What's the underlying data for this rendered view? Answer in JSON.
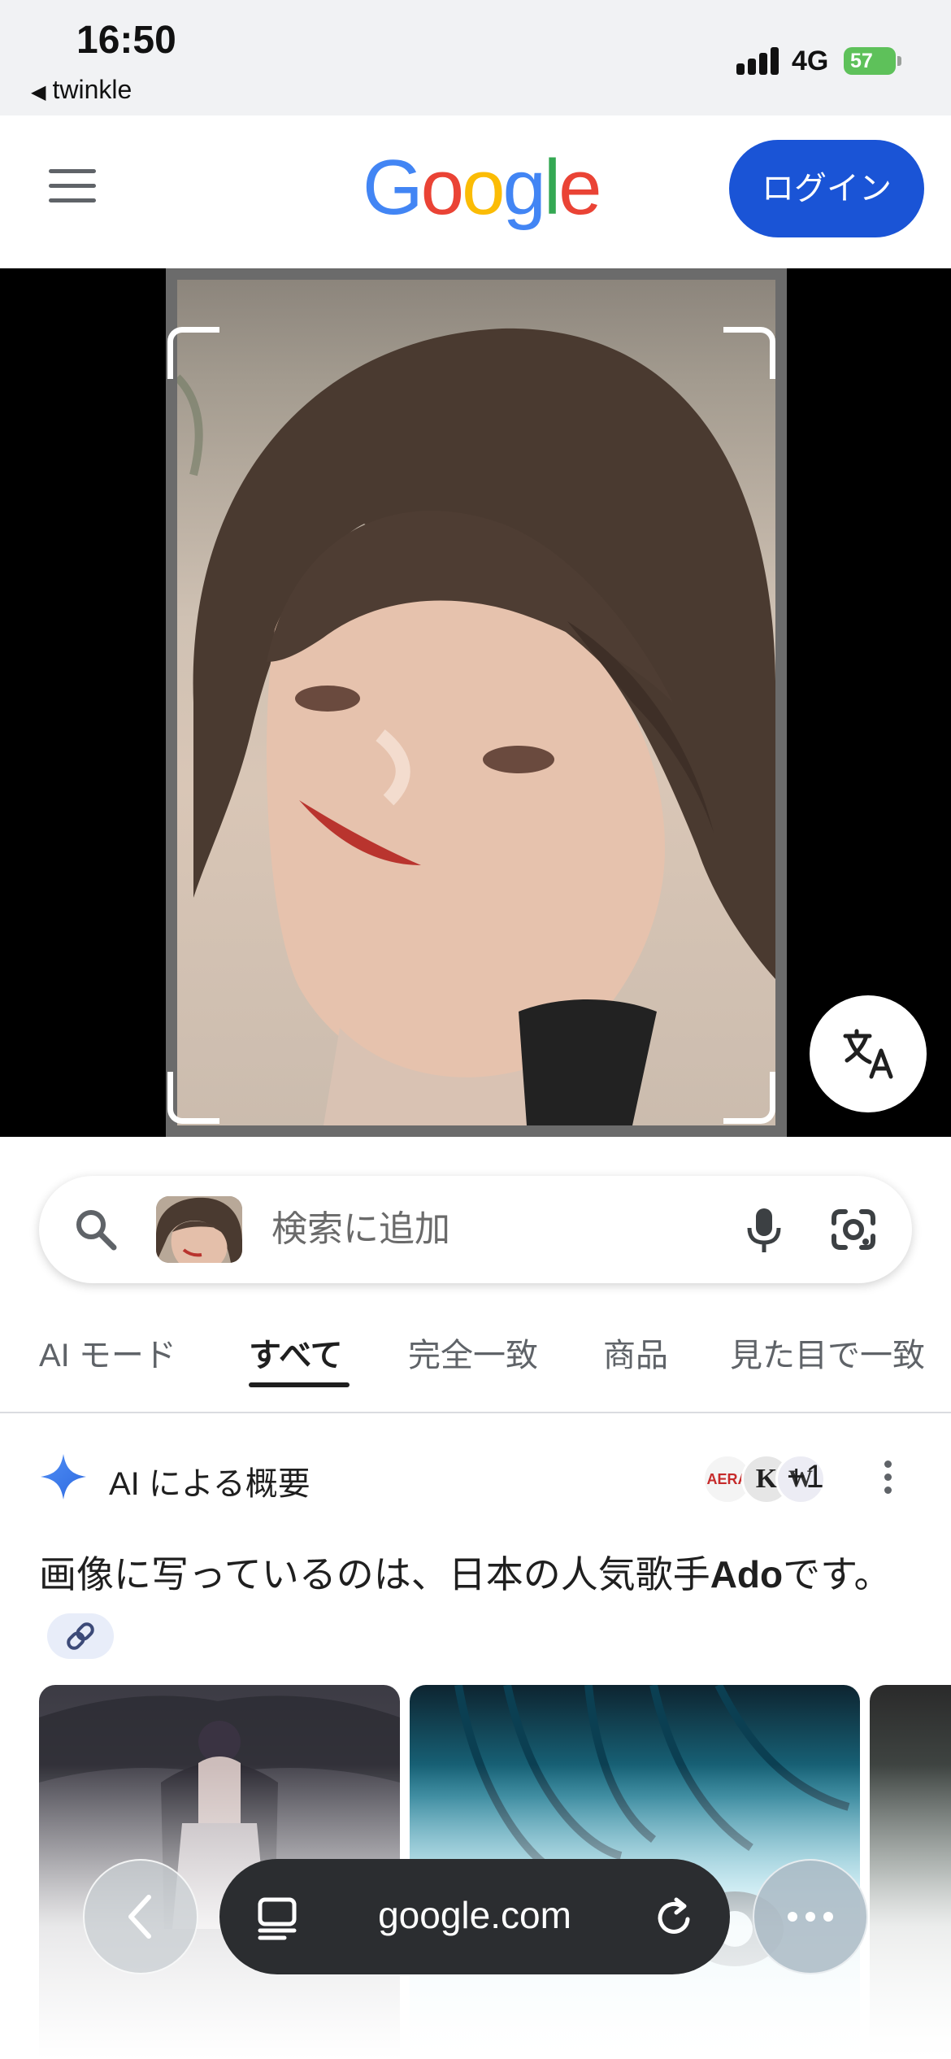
{
  "status_bar": {
    "time": "16:50",
    "back_app": "twinkle",
    "network": "4G",
    "battery": "57"
  },
  "header": {
    "logo": "Google",
    "logo_colors": [
      "#4285F4",
      "#EA4335",
      "#FBBC05",
      "#4285F4",
      "#34A853",
      "#EA4335"
    ],
    "login_label": "ログイン",
    "accent": "#1a54d6"
  },
  "viewer": {
    "translate_icon": "translate-icon"
  },
  "search": {
    "placeholder": "検索に追加",
    "icons": [
      "search-icon",
      "mic-icon",
      "lens-icon"
    ]
  },
  "tabs": [
    {
      "label": "AI モード"
    },
    {
      "label": "すべて",
      "active": true
    },
    {
      "label": "完全一致"
    },
    {
      "label": "商品"
    },
    {
      "label": "見た目で一致"
    }
  ],
  "ai_overview": {
    "title": "AI による概要",
    "source_badges": [
      "AERA",
      "K",
      "W"
    ],
    "source_count": "+1",
    "text_before": "画像に写っているのは、日本の人気歌手",
    "text_bold": "Ado",
    "text_after": "です。"
  },
  "browser_bar": {
    "url": "google.com"
  }
}
